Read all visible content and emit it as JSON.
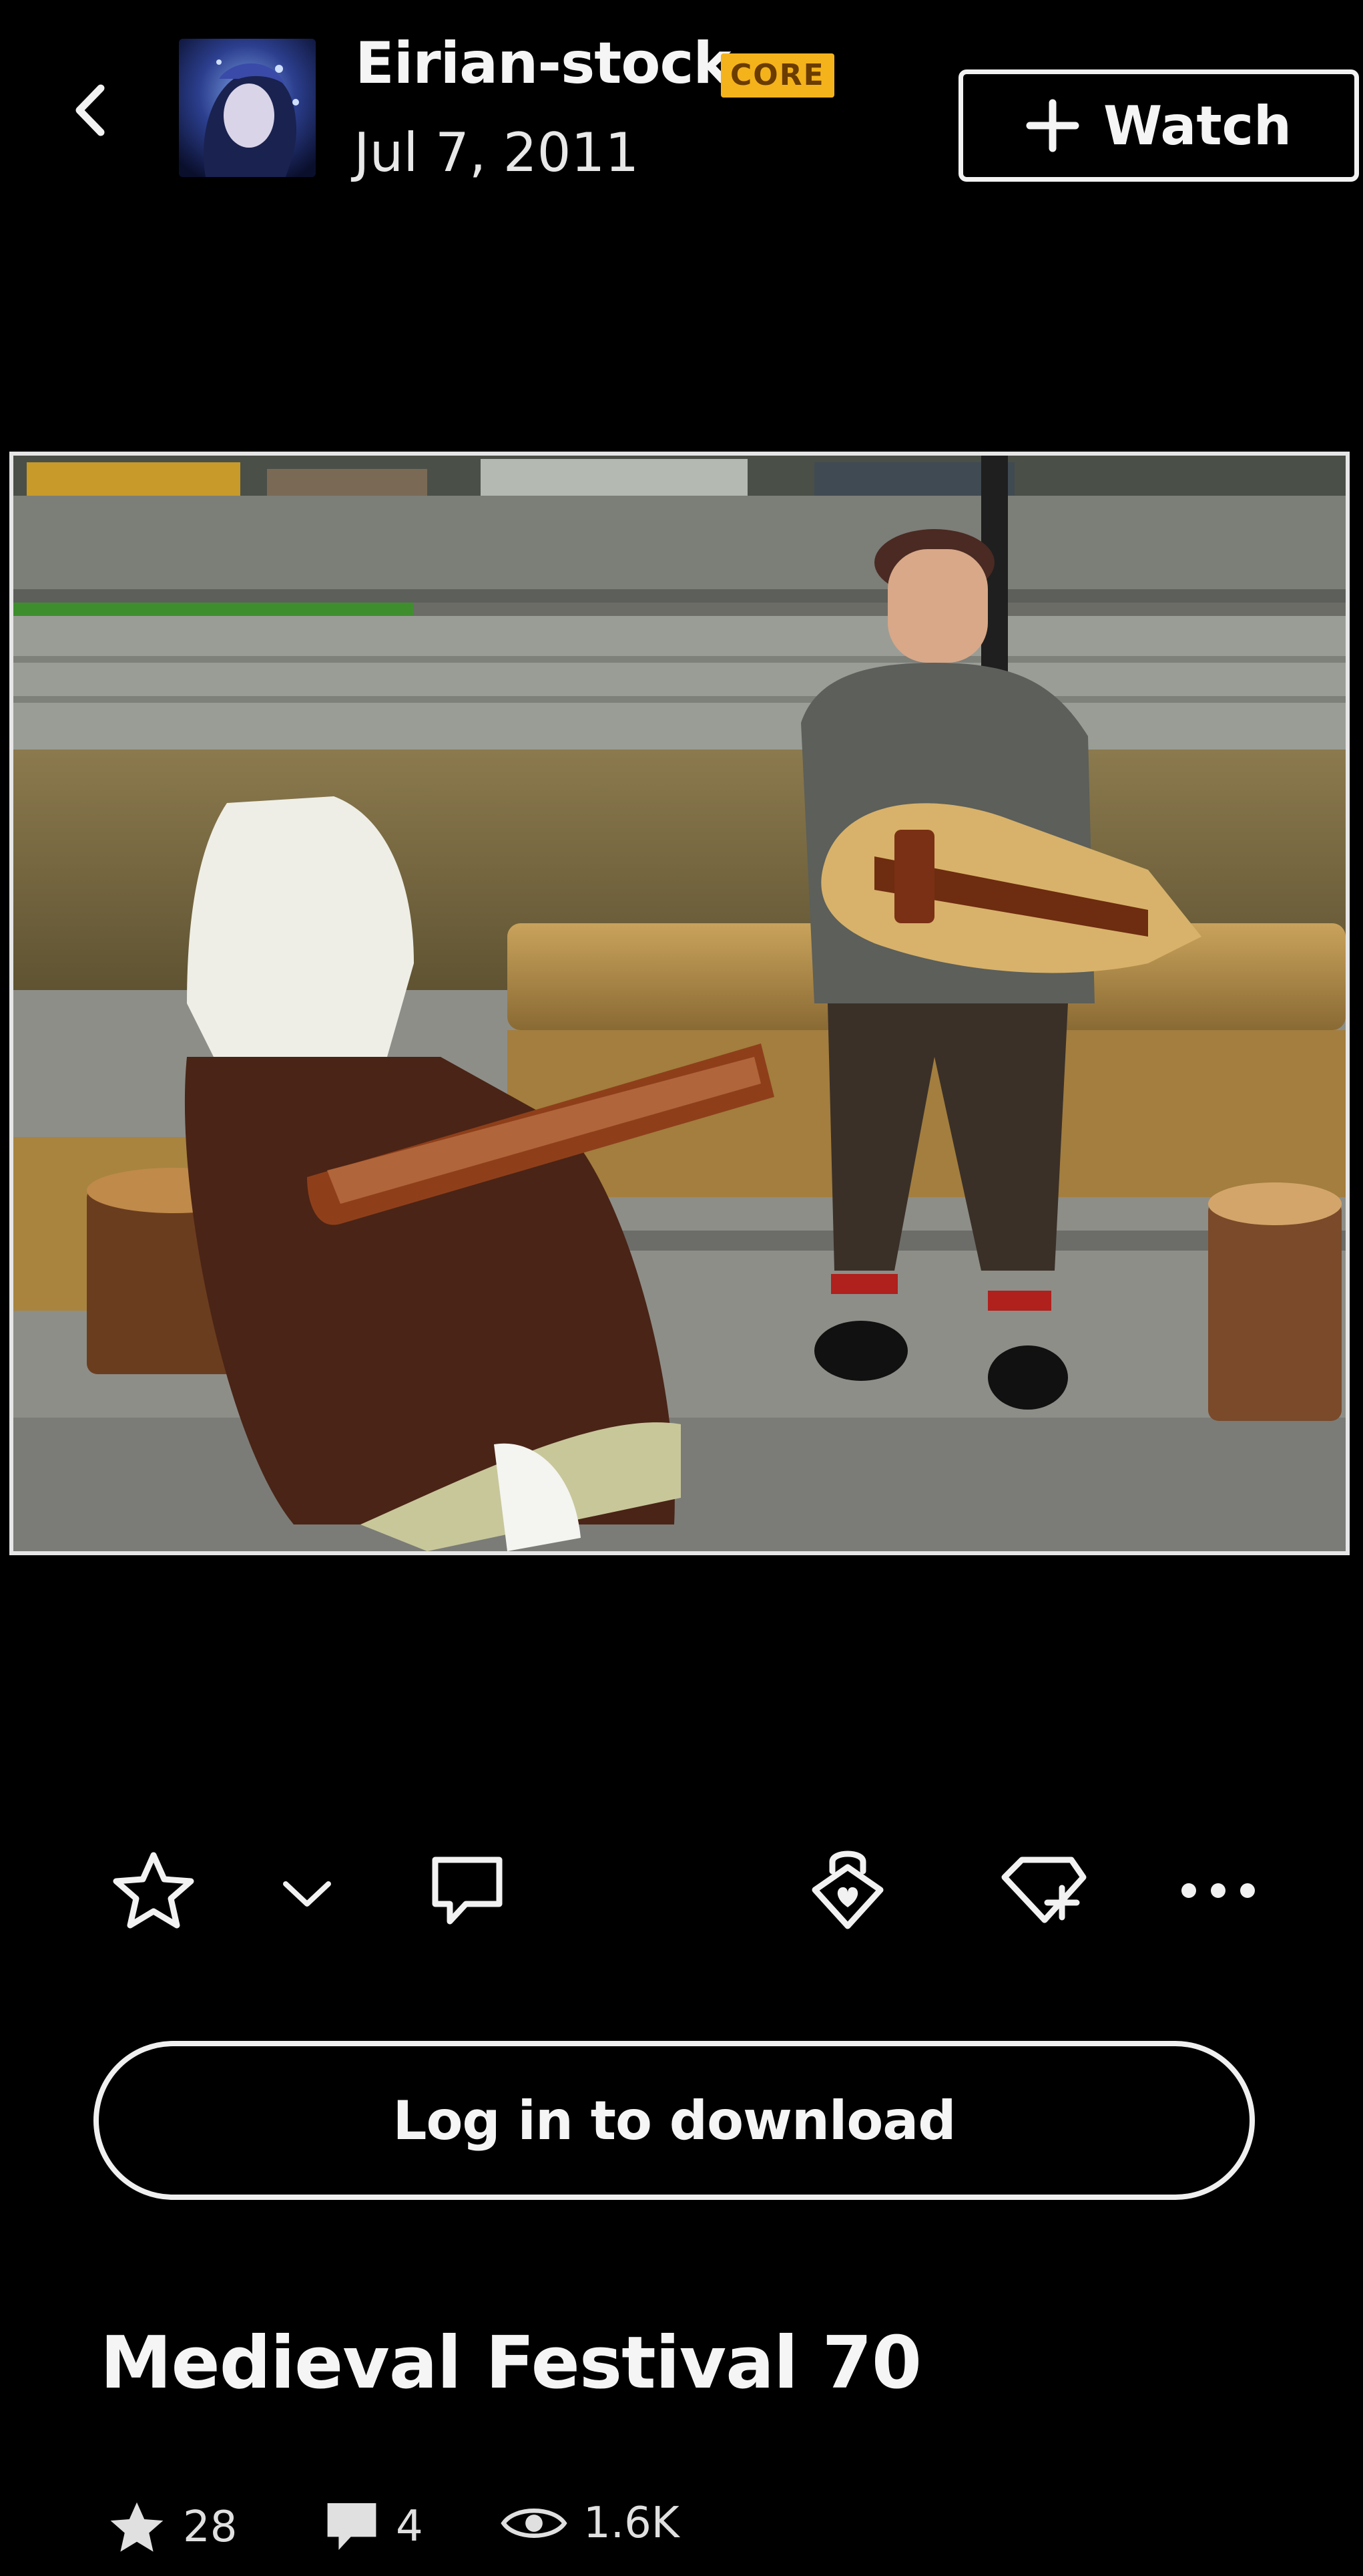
{
  "header": {
    "username": "Eirian-stock",
    "badge": "CORE",
    "date": "Jul 7, 2011",
    "watch_label": "Watch"
  },
  "actions": {
    "login_download_label": "Log in to download"
  },
  "deviation": {
    "title": "Medieval Festival 70"
  },
  "stats": {
    "favourites": "28",
    "comments": "4",
    "views": "1.6K"
  },
  "colors": {
    "background": "#000000",
    "foreground": "#f2f2f2",
    "core_badge": "#f5b31b"
  },
  "icons": [
    "back-chevron-icon",
    "plus-icon",
    "star-icon",
    "chevron-down-icon",
    "comment-icon",
    "lock-heart-icon",
    "collection-add-icon",
    "more-icon",
    "eye-icon"
  ]
}
